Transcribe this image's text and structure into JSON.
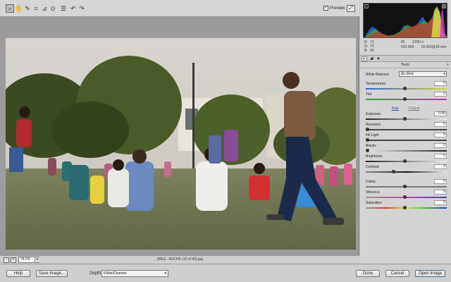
{
  "toolbar": {
    "tools": [
      "zoom-icon",
      "hand-icon",
      "eyedropper-icon",
      "crop-icon",
      "straighten-icon",
      "red-eye-icon",
      "list-icon",
      "rotate-left-icon",
      "rotate-right-icon"
    ],
    "preview_label": "Preview",
    "preview_checked": "✓"
  },
  "status": {
    "zoom": "78.5%",
    "minus": "-",
    "plus": "+",
    "filename": "JPEG  -  ADCHK (10 of 40).jpg"
  },
  "info": {
    "r_label": "R:",
    "r_value": "71",
    "g_label": "G:",
    "g_value": "73",
    "b_label": "B:",
    "b_value": "46",
    "aperture": "f/6",
    "shutter": "1/200 s",
    "iso": "ISO 800",
    "lens": "18-200@18 mm"
  },
  "panel": {
    "section_title": "Basic",
    "menu": "≡",
    "wb_label": "White Balance:",
    "wb_value": "As Shot",
    "auto": "Auto",
    "default": "Default"
  },
  "controls": [
    {
      "label": "Temperature",
      "value": "0"
    },
    {
      "label": "Tint",
      "value": "0"
    },
    {
      "label": "Exposure",
      "value": "0.00"
    },
    {
      "label": "Recovery",
      "value": "0"
    },
    {
      "label": "Fill Light",
      "value": "0"
    },
    {
      "label": "Blacks",
      "value": "0"
    },
    {
      "label": "Brightness",
      "value": "0"
    },
    {
      "label": "Contrast",
      "value": "0"
    },
    {
      "label": "Clarity",
      "value": "0"
    },
    {
      "label": "Vibrance",
      "value": "0"
    },
    {
      "label": "Saturation",
      "value": "0"
    }
  ],
  "footer": {
    "help": "Help",
    "save": "Save Image...",
    "depth_label": "Depth:",
    "depth_value": "8 Bits/Channel",
    "done": "Done",
    "cancel": "Cancel",
    "open": "Open Image"
  },
  "colors": {
    "accent": "#2050a0"
  }
}
